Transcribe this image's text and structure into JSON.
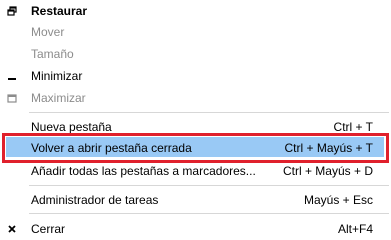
{
  "menu": {
    "items": [
      {
        "label": "Restaurar",
        "shortcut": "",
        "icon": "restore-icon",
        "state": "enabled-bold"
      },
      {
        "label": "Mover",
        "shortcut": "",
        "icon": "",
        "state": "disabled"
      },
      {
        "label": "Tamaño",
        "shortcut": "",
        "icon": "",
        "state": "disabled"
      },
      {
        "label": "Minimizar",
        "shortcut": "",
        "icon": "minimize-icon",
        "state": "enabled"
      },
      {
        "label": "Maximizar",
        "shortcut": "",
        "icon": "maximize-icon",
        "state": "disabled"
      },
      {
        "label": "Nueva pestaña",
        "shortcut": "Ctrl + T",
        "icon": "",
        "state": "enabled"
      },
      {
        "label": "Volver a abrir pestaña cerrada",
        "shortcut": "Ctrl + Mayús + T",
        "icon": "",
        "state": "highlighted"
      },
      {
        "label": "Añadir todas las pestañas a marcadores...",
        "shortcut": "Ctrl + Mayús + D",
        "icon": "",
        "state": "enabled"
      },
      {
        "label": "Administrador de tareas",
        "shortcut": "Mayús + Esc",
        "icon": "",
        "state": "enabled"
      },
      {
        "label": "Cerrar",
        "shortcut": "Alt+F4",
        "icon": "close-icon",
        "state": "enabled"
      }
    ]
  },
  "colors": {
    "highlight_fill": "#99c9f5",
    "highlight_frame": "#e0202c",
    "disabled_text": "#8c8c8c",
    "separator": "#d7d7d7"
  }
}
